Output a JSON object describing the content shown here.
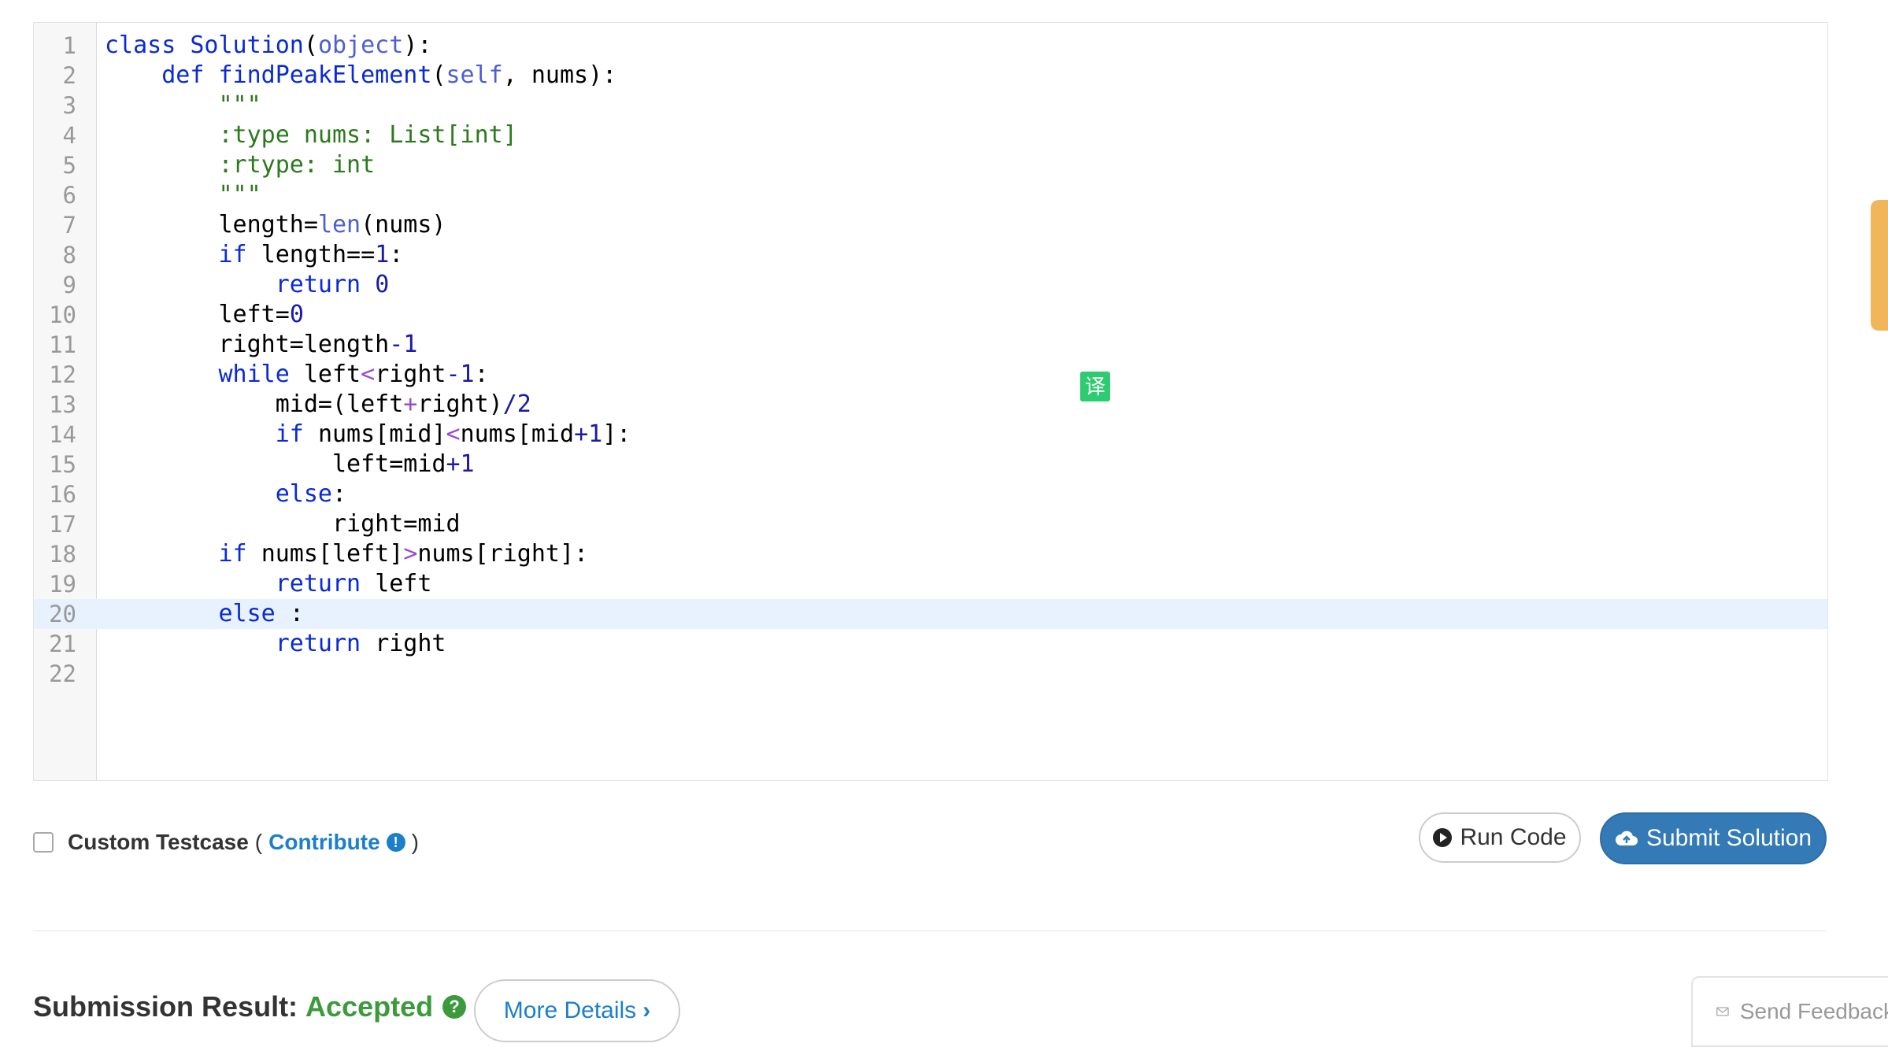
{
  "editor": {
    "active_line": 20,
    "lines": [
      {
        "n": "1",
        "tokens": [
          [
            "k",
            "class "
          ],
          [
            "fn",
            "Solution"
          ],
          [
            "",
            "("
          ],
          [
            "v",
            "object"
          ],
          [
            "",
            "):"
          ]
        ]
      },
      {
        "n": "2",
        "tokens": [
          [
            "",
            "    "
          ],
          [
            "k",
            "def "
          ],
          [
            "fn",
            "findPeakElement"
          ],
          [
            "",
            "("
          ],
          [
            "v",
            "self"
          ],
          [
            "",
            ", nums):"
          ]
        ]
      },
      {
        "n": "3",
        "tokens": [
          [
            "s",
            "        \"\"\""
          ]
        ]
      },
      {
        "n": "4",
        "tokens": [
          [
            "s",
            "        :type nums: List[int]"
          ]
        ]
      },
      {
        "n": "5",
        "tokens": [
          [
            "s",
            "        :rtype: int"
          ]
        ]
      },
      {
        "n": "6",
        "tokens": [
          [
            "s",
            "        \"\"\""
          ]
        ]
      },
      {
        "n": "7",
        "tokens": [
          [
            "",
            "        length="
          ],
          [
            "v",
            "len"
          ],
          [
            "",
            "(nums)"
          ]
        ]
      },
      {
        "n": "8",
        "tokens": [
          [
            "",
            "        "
          ],
          [
            "k",
            "if "
          ],
          [
            "",
            "length=="
          ],
          [
            "n",
            "1"
          ],
          [
            "",
            ":"
          ]
        ]
      },
      {
        "n": "9",
        "tokens": [
          [
            "",
            "            "
          ],
          [
            "k",
            "return "
          ],
          [
            "n",
            "0"
          ]
        ]
      },
      {
        "n": "10",
        "tokens": [
          [
            "",
            "        left="
          ],
          [
            "n",
            "0"
          ]
        ]
      },
      {
        "n": "11",
        "tokens": [
          [
            "",
            "        right=length"
          ],
          [
            "n",
            "-1"
          ]
        ]
      },
      {
        "n": "12",
        "tokens": [
          [
            "",
            "        "
          ],
          [
            "k",
            "while "
          ],
          [
            "",
            "left"
          ],
          [
            "o",
            "<"
          ],
          [
            "",
            "right"
          ],
          [
            "n",
            "-1"
          ],
          [
            "",
            ":"
          ]
        ]
      },
      {
        "n": "13",
        "tokens": [
          [
            "",
            "            mid=(left"
          ],
          [
            "o",
            "+"
          ],
          [
            "",
            "right)"
          ],
          [
            "n",
            "/2"
          ]
        ]
      },
      {
        "n": "14",
        "tokens": [
          [
            "",
            "            "
          ],
          [
            "k",
            "if "
          ],
          [
            "",
            "nums[mid]"
          ],
          [
            "o",
            "<"
          ],
          [
            "",
            "nums[mid"
          ],
          [
            "n",
            "+1"
          ],
          [
            "",
            "]:"
          ]
        ]
      },
      {
        "n": "15",
        "tokens": [
          [
            "",
            "                left=mid"
          ],
          [
            "n",
            "+1"
          ]
        ]
      },
      {
        "n": "16",
        "tokens": [
          [
            "",
            "            "
          ],
          [
            "k",
            "else"
          ],
          [
            "",
            ":"
          ]
        ]
      },
      {
        "n": "17",
        "tokens": [
          [
            "",
            "                right=mid"
          ]
        ]
      },
      {
        "n": "18",
        "tokens": [
          [
            "",
            "        "
          ],
          [
            "k",
            "if "
          ],
          [
            "",
            "nums[left]"
          ],
          [
            "o",
            ">"
          ],
          [
            "",
            "nums[right]:"
          ]
        ]
      },
      {
        "n": "19",
        "tokens": [
          [
            "",
            "            "
          ],
          [
            "k",
            "return "
          ],
          [
            "",
            "left"
          ]
        ]
      },
      {
        "n": "20",
        "tokens": [
          [
            "",
            "        "
          ],
          [
            "k",
            "else "
          ],
          [
            "",
            ":"
          ]
        ]
      },
      {
        "n": "21",
        "tokens": [
          [
            "",
            "            "
          ],
          [
            "k",
            "return "
          ],
          [
            "",
            "right"
          ]
        ]
      },
      {
        "n": "22",
        "tokens": [
          [
            "",
            ""
          ]
        ]
      }
    ]
  },
  "translate_badge": "译",
  "testcase": {
    "label": "Custom Testcase",
    "open_paren": "(",
    "contribute": "Contribute",
    "info_glyph": "!",
    "close_paren": ")"
  },
  "buttons": {
    "run": "Run Code",
    "submit": "Submit Solution",
    "details": "More Details"
  },
  "result": {
    "label": "Submission Result:",
    "status": "Accepted",
    "help_glyph": "?"
  },
  "feedback": "Send Feedback",
  "colors": {
    "accepted": "#3c9a3c",
    "primary": "#337ab7",
    "link": "#1c7fc9",
    "active_line": "#e8f2fe"
  }
}
